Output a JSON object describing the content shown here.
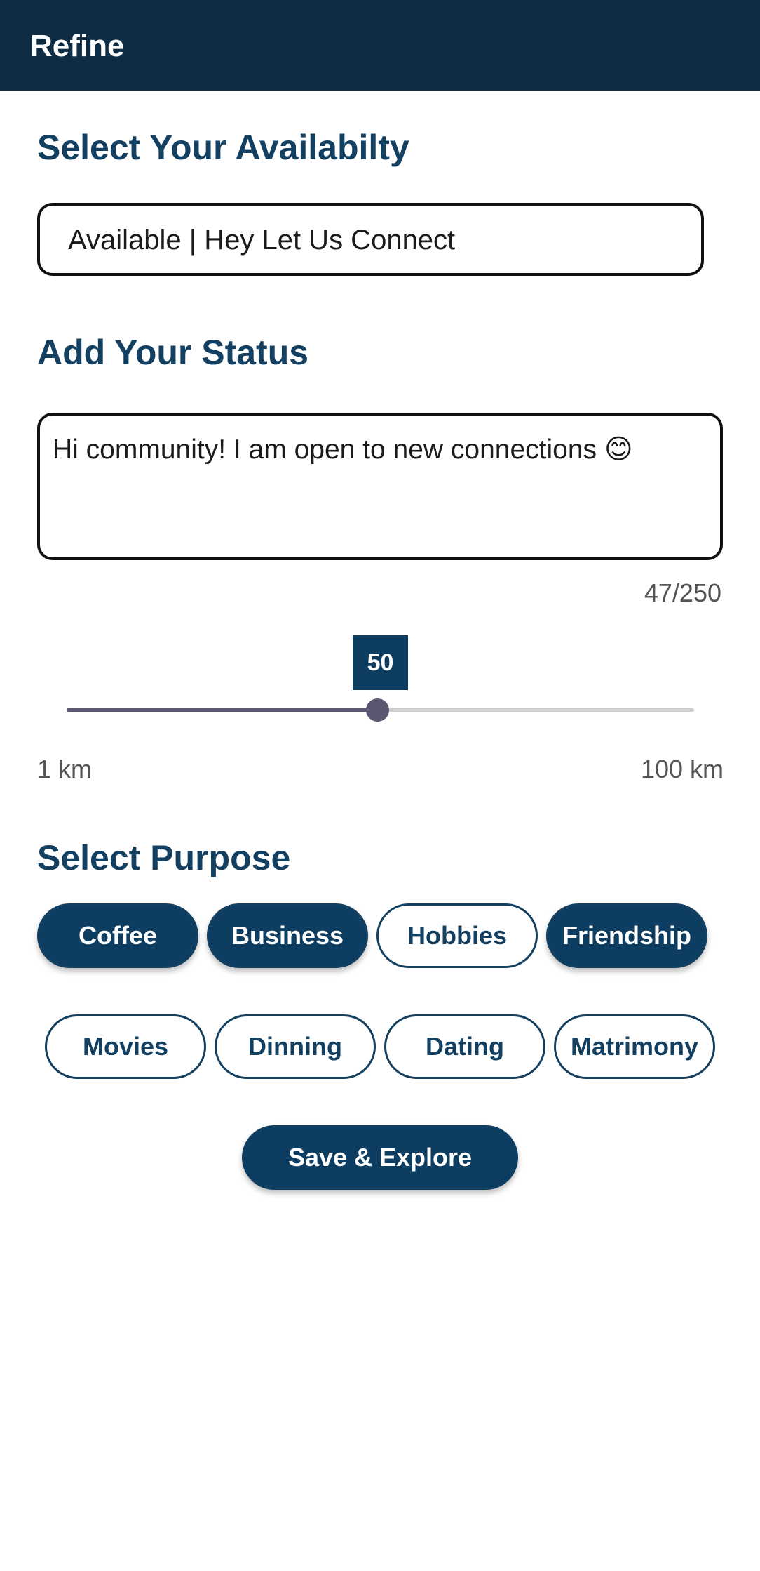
{
  "app_bar": {
    "title": "Refine"
  },
  "availability": {
    "heading": "Select Your Availabilty",
    "selected_value": "Available | Hey Let Us Connect"
  },
  "status": {
    "heading": "Add Your Status",
    "text": "Hi community! I am open to new connections 😊",
    "char_count": "47/250"
  },
  "distance": {
    "value": 50,
    "value_label": "50",
    "min": 1,
    "max": 100,
    "min_label": "1 km",
    "max_label": "100 km"
  },
  "purpose": {
    "heading": "Select Purpose",
    "chips": [
      {
        "label": "Coffee",
        "selected": true
      },
      {
        "label": "Business",
        "selected": true
      },
      {
        "label": "Hobbies",
        "selected": false
      },
      {
        "label": "Friendship",
        "selected": true
      },
      {
        "label": "Movies",
        "selected": false
      },
      {
        "label": "Dinning",
        "selected": false
      },
      {
        "label": "Dating",
        "selected": false
      },
      {
        "label": "Matrimony",
        "selected": false
      }
    ]
  },
  "actions": {
    "save_label": "Save & Explore"
  },
  "colors": {
    "primary": "#0e3d62",
    "app_bar": "#0e2d44",
    "heading": "#133f60",
    "slider": "#5a5772"
  }
}
